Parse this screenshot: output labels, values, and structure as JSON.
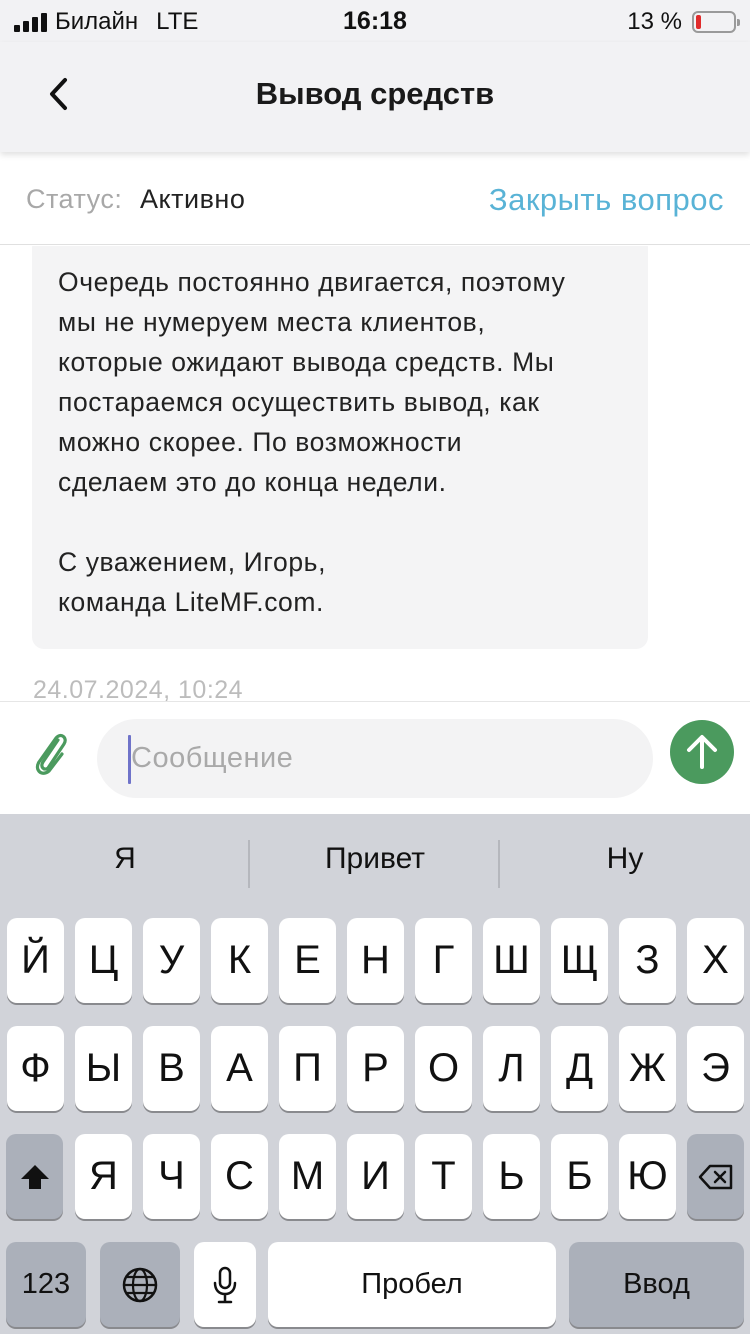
{
  "status_bar": {
    "carrier": "Билайн",
    "network": "LTE",
    "time": "16:18",
    "battery": "13 %",
    "battery_level": 0.13
  },
  "header": {
    "title": "Вывод средств"
  },
  "ticket": {
    "status_label": "Статус:",
    "status_value": "Активно",
    "close_label": "Закрыть вопрос"
  },
  "messages": [
    {
      "text": "Очередь постоянно двигается, поэтому\nмы не нумеруем места клиентов,\nкоторые ожидают вывода средств. Мы\nпостараемся осуществить вывод, как\nможно скорее. По возможности\nсделаем это до конца недели.\n\nС уважением, Игорь,\nкоманда LiteMF.com.",
      "timestamp": "24.07.2024, 10:24"
    }
  ],
  "composer": {
    "placeholder": "Сообщение",
    "value": ""
  },
  "keyboard": {
    "suggestions": [
      "Я",
      "Привет",
      "Ну"
    ],
    "row1": [
      "Й",
      "Ц",
      "У",
      "К",
      "Е",
      "Н",
      "Г",
      "Ш",
      "Щ",
      "З",
      "Х"
    ],
    "row2": [
      "Ф",
      "Ы",
      "В",
      "А",
      "П",
      "Р",
      "О",
      "Л",
      "Д",
      "Ж",
      "Э"
    ],
    "row3": [
      "Я",
      "Ч",
      "С",
      "М",
      "И",
      "Т",
      "Ь",
      "Б",
      "Ю"
    ],
    "numbers_key": "123",
    "space_key": "Пробел",
    "return_key": "Ввод"
  },
  "colors": {
    "accent_link": "#59b3d6",
    "send_button": "#4b9a5e",
    "attach_icon": "#4b9a5e"
  },
  "icons": [
    "back-chevron-icon",
    "paperclip-icon",
    "send-arrow-icon",
    "shift-icon",
    "backspace-icon",
    "globe-icon",
    "microphone-icon",
    "battery-icon",
    "signal-icon"
  ]
}
